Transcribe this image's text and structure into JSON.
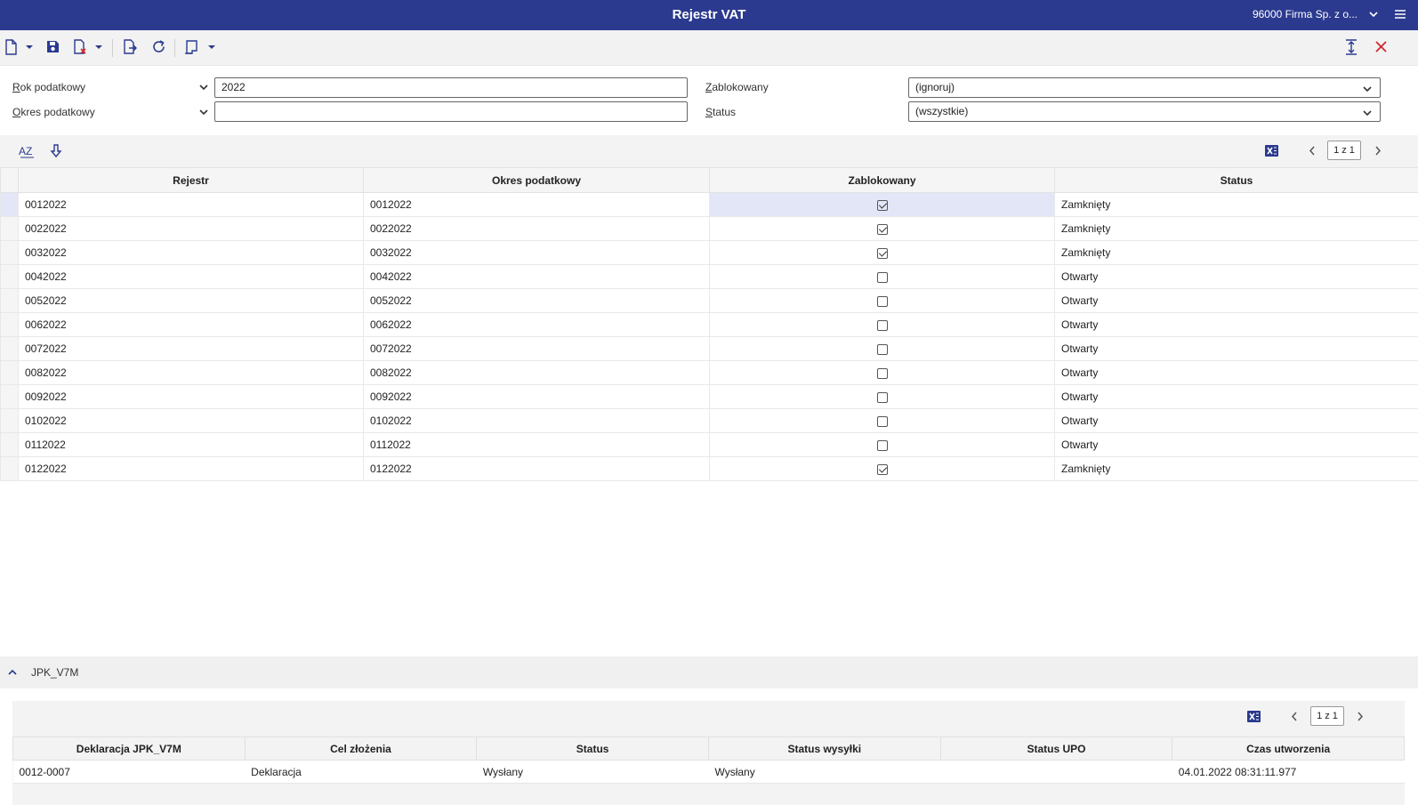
{
  "app": {
    "title": "Rejestr VAT",
    "company": "96000  Firma Sp. z o...",
    "accent": "#2b3a8f"
  },
  "toolbar": {
    "icons": [
      "new-document-icon",
      "save-icon",
      "delete-icon",
      "export-icon",
      "refresh-icon",
      "print-icon",
      "collapse-vertical-icon",
      "close-icon"
    ]
  },
  "filters": {
    "rok_label_u": "R",
    "rok_label_rest": "ok podatkowy",
    "rok_value": "2022",
    "okres_label_u": "O",
    "okres_label_rest": "kres podatkowy",
    "okres_value": "",
    "zablokowany_label_u": "Z",
    "zablokowany_label_rest": "ablokowany",
    "zablokowany_value": "(ignoruj)",
    "status_label_u": "S",
    "status_label_rest": "tatus",
    "status_value": "(wszystkie)"
  },
  "grid": {
    "pager": "1 z 1",
    "columns": [
      "Rejestr",
      "Okres podatkowy",
      "Zablokowany",
      "Status"
    ],
    "rows": [
      {
        "rejestr": "0012022",
        "okres": "0012022",
        "zablokowany": true,
        "status": "Zamknięty"
      },
      {
        "rejestr": "0022022",
        "okres": "0022022",
        "zablokowany": true,
        "status": "Zamknięty"
      },
      {
        "rejestr": "0032022",
        "okres": "0032022",
        "zablokowany": true,
        "status": "Zamknięty"
      },
      {
        "rejestr": "0042022",
        "okres": "0042022",
        "zablokowany": false,
        "status": "Otwarty"
      },
      {
        "rejestr": "0052022",
        "okres": "0052022",
        "zablokowany": false,
        "status": "Otwarty"
      },
      {
        "rejestr": "0062022",
        "okres": "0062022",
        "zablokowany": false,
        "status": "Otwarty"
      },
      {
        "rejestr": "0072022",
        "okres": "0072022",
        "zablokowany": false,
        "status": "Otwarty"
      },
      {
        "rejestr": "0082022",
        "okres": "0082022",
        "zablokowany": false,
        "status": "Otwarty"
      },
      {
        "rejestr": "0092022",
        "okres": "0092022",
        "zablokowany": false,
        "status": "Otwarty"
      },
      {
        "rejestr": "0102022",
        "okres": "0102022",
        "zablokowany": false,
        "status": "Otwarty"
      },
      {
        "rejestr": "0112022",
        "okres": "0112022",
        "zablokowany": false,
        "status": "Otwarty"
      },
      {
        "rejestr": "0122022",
        "okres": "0122022",
        "zablokowany": true,
        "status": "Zamknięty"
      }
    ]
  },
  "section": {
    "label": "JPK_V7M"
  },
  "subgrid": {
    "pager": "1 z 1",
    "columns": [
      "Deklaracja JPK_V7M",
      "Cel złożenia",
      "Status",
      "Status wysyłki",
      "Status UPO",
      "Czas utworzenia"
    ],
    "rows": [
      [
        "0012-0007",
        "Deklaracja",
        "Wysłany",
        "Wysłany",
        "",
        "04.01.2022 08:31:11.977"
      ]
    ]
  }
}
